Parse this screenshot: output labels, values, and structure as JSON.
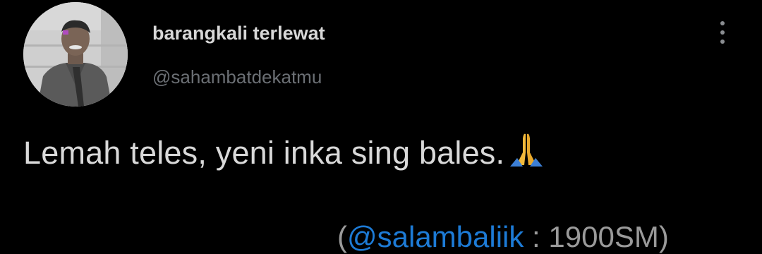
{
  "tweet": {
    "display_name": "barangkali terlewat",
    "handle": "@sahambatdekatmu",
    "text": "Lemah teles, yeni inka sing bales.",
    "emoji": "folded-hands",
    "more_icon": "more-vertical-icon"
  },
  "credit": {
    "open": "(",
    "mention": "@salambaliik",
    "rest": " : 1900SM)"
  },
  "colors": {
    "background": "#000000",
    "name": "#d7d7d7",
    "handle": "#6b6f74",
    "text": "#d9d9d9",
    "mention": "#1d7bd6"
  }
}
